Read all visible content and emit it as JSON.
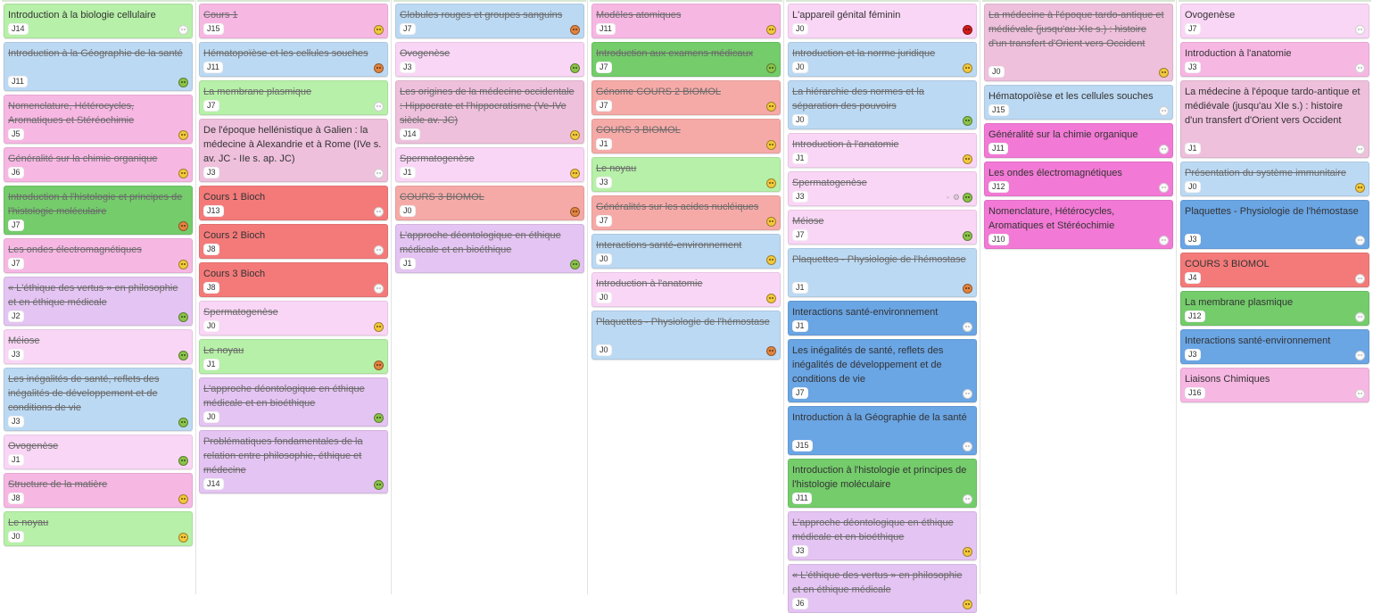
{
  "colors": {
    "green": "#b7f0a8",
    "green_dark": "#74cc6b",
    "blue": "#bcd9f3",
    "blue_dark": "#6aa5e4",
    "pink": "#f7b7e3",
    "pink_dark": "#f279d5",
    "pink_light": "#fad6f6",
    "lavender": "#e4c4f2",
    "red": "#f47a7a",
    "salmon": "#f6aaa7",
    "rose": "#eec0dc"
  },
  "columns": [
    {
      "cards": [
        {
          "title": "Introduction à la biologie cellulaire",
          "badge": "J14",
          "color": "green",
          "face": "white",
          "done": false
        },
        {
          "title": "Introduction à la Géographie de la santé",
          "badge": "J11",
          "color": "blue",
          "face": "green",
          "done": true
        },
        {
          "title": "Nomenclature, Hétérocycles, Aromatiques et Stéréochimie",
          "badge": "J5",
          "color": "pink",
          "face": "yellow",
          "done": true
        },
        {
          "title": "Généralité sur la chimie organique",
          "badge": "J6",
          "color": "pink",
          "face": "yellow",
          "done": true
        },
        {
          "title": "Introduction à l'histologie et principes de l'histologie moléculaire",
          "badge": "J7",
          "color": "green_dark",
          "face": "orange",
          "done": true
        },
        {
          "title": "Les ondes électromagnétiques",
          "badge": "J7",
          "color": "pink",
          "face": "yellow",
          "done": true
        },
        {
          "title": "« L'éthique des vertus » en philosophie et en éthique médicale",
          "badge": "J2",
          "color": "lavender",
          "face": "green",
          "done": true
        },
        {
          "title": "Méiose",
          "badge": "J3",
          "color": "pink_light",
          "face": "green",
          "done": true
        },
        {
          "title": "Les inégalités de santé, reflets des inégalités de développement et de conditions de vie",
          "badge": "J3",
          "color": "blue",
          "face": "green",
          "done": true
        },
        {
          "title": "Ovogenèse",
          "badge": "J1",
          "color": "pink_light",
          "face": "green",
          "done": true
        },
        {
          "title": "Structure de la matière",
          "badge": "J8",
          "color": "pink",
          "face": "yellow",
          "done": true
        },
        {
          "title": "Le noyau",
          "badge": "J0",
          "color": "green",
          "face": "yellow",
          "done": true
        }
      ]
    },
    {
      "cards": [
        {
          "title": "Cours 1",
          "badge": "J15",
          "color": "pink",
          "face": "yellow",
          "done": true
        },
        {
          "title": "Hématopoïèse et les cellules souches",
          "badge": "J11",
          "color": "blue",
          "face": "orange",
          "done": true
        },
        {
          "title": "La membrane plasmique",
          "badge": "J7",
          "color": "green",
          "face": "white",
          "done": true
        },
        {
          "title": "De l'époque hellénistique à Galien : la médecine à Alexandrie et à Rome (IVe s. av. JC - IIe s. ap. JC)",
          "badge": "J3",
          "color": "rose",
          "face": "white",
          "done": false
        },
        {
          "title": "Cours 1 Bioch",
          "badge": "J13",
          "color": "red",
          "face": "white",
          "done": false
        },
        {
          "title": "Cours 2 Bioch",
          "badge": "J8",
          "color": "red",
          "face": "white",
          "done": false
        },
        {
          "title": "Cours 3 Bioch",
          "badge": "J8",
          "color": "red",
          "face": "white",
          "done": false
        },
        {
          "title": "Spermatogenèse",
          "badge": "J0",
          "color": "pink_light",
          "face": "yellow",
          "done": true
        },
        {
          "title": "Le noyau",
          "badge": "J1",
          "color": "green",
          "face": "orange",
          "done": true
        },
        {
          "title": "L'approche déontologique en éthique médicale et en bioéthique",
          "badge": "J0",
          "color": "lavender",
          "face": "green",
          "done": true
        },
        {
          "title": "Problématiques fondamentales de la relation entre philosophie, éthique et médecine",
          "badge": "J14",
          "color": "lavender",
          "face": "green",
          "done": true
        }
      ]
    },
    {
      "cards": [
        {
          "title": "Globules rouges et groupes sanguins",
          "badge": "J7",
          "color": "blue",
          "face": "orange",
          "done": true
        },
        {
          "title": "Ovogenèse",
          "badge": "J3",
          "color": "pink_light",
          "face": "green",
          "done": true
        },
        {
          "title": "Les origines de la médecine occidentale : Hippocrate et l'hippocratisme (Ve-IVe siècle av. JC)",
          "badge": "J14",
          "color": "rose",
          "face": "yellow",
          "done": true
        },
        {
          "title": "Spermatogenèse",
          "badge": "J1",
          "color": "pink_light",
          "face": "yellow",
          "done": true
        },
        {
          "title": "COURS 3 BIOMOL",
          "badge": "J0",
          "color": "salmon",
          "face": "orange",
          "done": true
        },
        {
          "title": "L'approche déontologique en éthique médicale et en bioéthique",
          "badge": "J1",
          "color": "lavender",
          "face": "green",
          "done": true
        }
      ]
    },
    {
      "cards": [
        {
          "title": "Modèles atomiques",
          "badge": "J11",
          "color": "pink",
          "face": "yellow",
          "done": true
        },
        {
          "title": "Introduction aux examens médicaux",
          "badge": "J7",
          "color": "green_dark",
          "face": "green",
          "done": true
        },
        {
          "title": "Génome COURS 2 BIOMOL",
          "badge": "J7",
          "color": "salmon",
          "face": "yellow",
          "done": true
        },
        {
          "title": "COURS 3 BIOMOL",
          "badge": "J1",
          "color": "salmon",
          "face": "yellow",
          "done": true
        },
        {
          "title": "Le noyau",
          "badge": "J3",
          "color": "green",
          "face": "yellow",
          "done": true
        },
        {
          "title": "Généralités sur les acides nucléiques",
          "badge": "J7",
          "color": "salmon",
          "face": "yellow",
          "done": true
        },
        {
          "title": "Interactions santé-environnement",
          "badge": "J0",
          "color": "blue",
          "face": "yellow",
          "done": true
        },
        {
          "title": "Introduction à l'anatomie",
          "badge": "J0",
          "color": "pink_light",
          "face": "yellow",
          "done": true
        },
        {
          "title": "Plaquettes - Physiologie de l'hémostase",
          "badge": "J0",
          "color": "blue",
          "face": "orange",
          "done": true
        }
      ]
    },
    {
      "cards": [
        {
          "title": "L'appareil génital féminin",
          "badge": "J0",
          "color": "pink_light",
          "face": "red",
          "done": false
        },
        {
          "title": "Introduction et la norme juridique",
          "badge": "J0",
          "color": "blue",
          "face": "yellow",
          "done": true
        },
        {
          "title": "La hiérarchie des normes et la séparation des pouvoirs",
          "badge": "J0",
          "color": "blue",
          "face": "green",
          "done": true
        },
        {
          "title": "Introduction à l'anatomie",
          "badge": "J1",
          "color": "pink_light",
          "face": "yellow",
          "done": true
        },
        {
          "title": "Spermatogenèse",
          "badge": "J3",
          "color": "pink_light",
          "face": "green",
          "done": true,
          "extra": true
        },
        {
          "title": "Méiose",
          "badge": "J7",
          "color": "pink_light",
          "face": "green",
          "done": true
        },
        {
          "title": "Plaquettes - Physiologie de l'hémostase",
          "badge": "J1",
          "color": "blue",
          "face": "orange",
          "done": true
        },
        {
          "title": "Interactions santé-environnement",
          "badge": "J1",
          "color": "blue_dark",
          "face": "white",
          "done": false
        },
        {
          "title": "Les inégalités de santé, reflets des inégalités de développement et de conditions de vie",
          "badge": "J7",
          "color": "blue_dark",
          "face": "white",
          "done": false
        },
        {
          "title": "Introduction à la Géographie de la santé",
          "badge": "J15",
          "color": "blue_dark",
          "face": "white",
          "done": false
        },
        {
          "title": "Introduction à l'histologie et principes de l'histologie moléculaire",
          "badge": "J11",
          "color": "green_dark",
          "face": "white",
          "done": false
        },
        {
          "title": "L'approche déontologique en éthique médicale et en bioéthique",
          "badge": "J3",
          "color": "lavender",
          "face": "yellow",
          "done": true
        },
        {
          "title": "« L'éthique des vertus » en philosophie et en éthique médicale",
          "badge": "J6",
          "color": "lavender",
          "face": "yellow",
          "done": true
        }
      ]
    },
    {
      "cards": [
        {
          "title": "La médecine à l'époque tardo-antique et médiévale (jusqu'au XIe s.) : histoire d'un transfert d'Orient vers Occident",
          "badge": "J0",
          "color": "rose",
          "face": "yellow",
          "done": true
        },
        {
          "title": "Hématopoïèse et les cellules souches",
          "badge": "J15",
          "color": "blue",
          "face": "white",
          "done": false
        },
        {
          "title": "Généralité sur la chimie organique",
          "badge": "J11",
          "color": "pink_dark",
          "face": "white",
          "done": false
        },
        {
          "title": "Les ondes électromagnétiques",
          "badge": "J12",
          "color": "pink_dark",
          "face": "white",
          "done": false
        },
        {
          "title": "Nomenclature, Hétérocycles, Aromatiques et Stéréochimie",
          "badge": "J10",
          "color": "pink_dark",
          "face": "white",
          "done": false
        }
      ]
    },
    {
      "cards": [
        {
          "title": "Ovogenèse",
          "badge": "J7",
          "color": "pink_light",
          "face": "white",
          "done": false
        },
        {
          "title": "Introduction à l'anatomie",
          "badge": "J3",
          "color": "pink",
          "face": "white",
          "done": false
        },
        {
          "title": "La médecine à l'époque tardo-antique et médiévale (jusqu'au XIe s.) : histoire d'un transfert d'Orient vers Occident",
          "badge": "J1",
          "color": "rose",
          "face": "white",
          "done": false
        },
        {
          "title": "Présentation du système immunitaire",
          "badge": "J0",
          "color": "blue",
          "face": "yellow",
          "done": true
        },
        {
          "title": "Plaquettes - Physiologie de l'hémostase",
          "badge": "J3",
          "color": "blue_dark",
          "face": "white",
          "done": false
        },
        {
          "title": "COURS 3 BIOMOL",
          "badge": "J4",
          "color": "red",
          "face": "white",
          "done": false
        },
        {
          "title": "La membrane plasmique",
          "badge": "J12",
          "color": "green_dark",
          "face": "white",
          "done": false
        },
        {
          "title": "Interactions santé-environnement",
          "badge": "J3",
          "color": "blue_dark",
          "face": "white",
          "done": false
        },
        {
          "title": "Liaisons Chimiques",
          "badge": "J16",
          "color": "pink",
          "face": "white",
          "done": false
        }
      ]
    }
  ]
}
